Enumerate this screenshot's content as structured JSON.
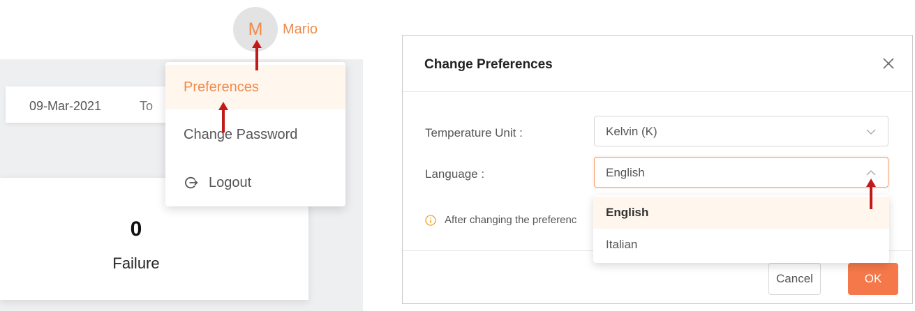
{
  "header": {
    "avatar_initial": "M",
    "username": "Mario"
  },
  "date_filter": {
    "from_date": "09-Mar-2021",
    "to_label": "To"
  },
  "stat_card": {
    "value": "0",
    "label": "Failure"
  },
  "user_menu": {
    "items": [
      {
        "label": "Preferences",
        "active": true
      },
      {
        "label": "Change Password"
      },
      {
        "label": "Logout",
        "icon": "logout-icon"
      }
    ]
  },
  "dialog": {
    "title": "Change Preferences",
    "close_icon": "close-icon",
    "fields": {
      "temperature": {
        "label": "Temperature Unit :",
        "value": "Kelvin (K)"
      },
      "language": {
        "label": "Language :",
        "value": "English"
      }
    },
    "info_text": "After changing the preferenc",
    "language_options": [
      {
        "label": "English",
        "selected": true
      },
      {
        "label": "Italian"
      }
    ],
    "cancel_label": "Cancel",
    "ok_label": "OK"
  },
  "colors": {
    "accent": "#f08a4b",
    "ok_button": "#f4784a",
    "annotation_arrow": "#c21a1a",
    "highlight_bg": "#fff6ee"
  }
}
